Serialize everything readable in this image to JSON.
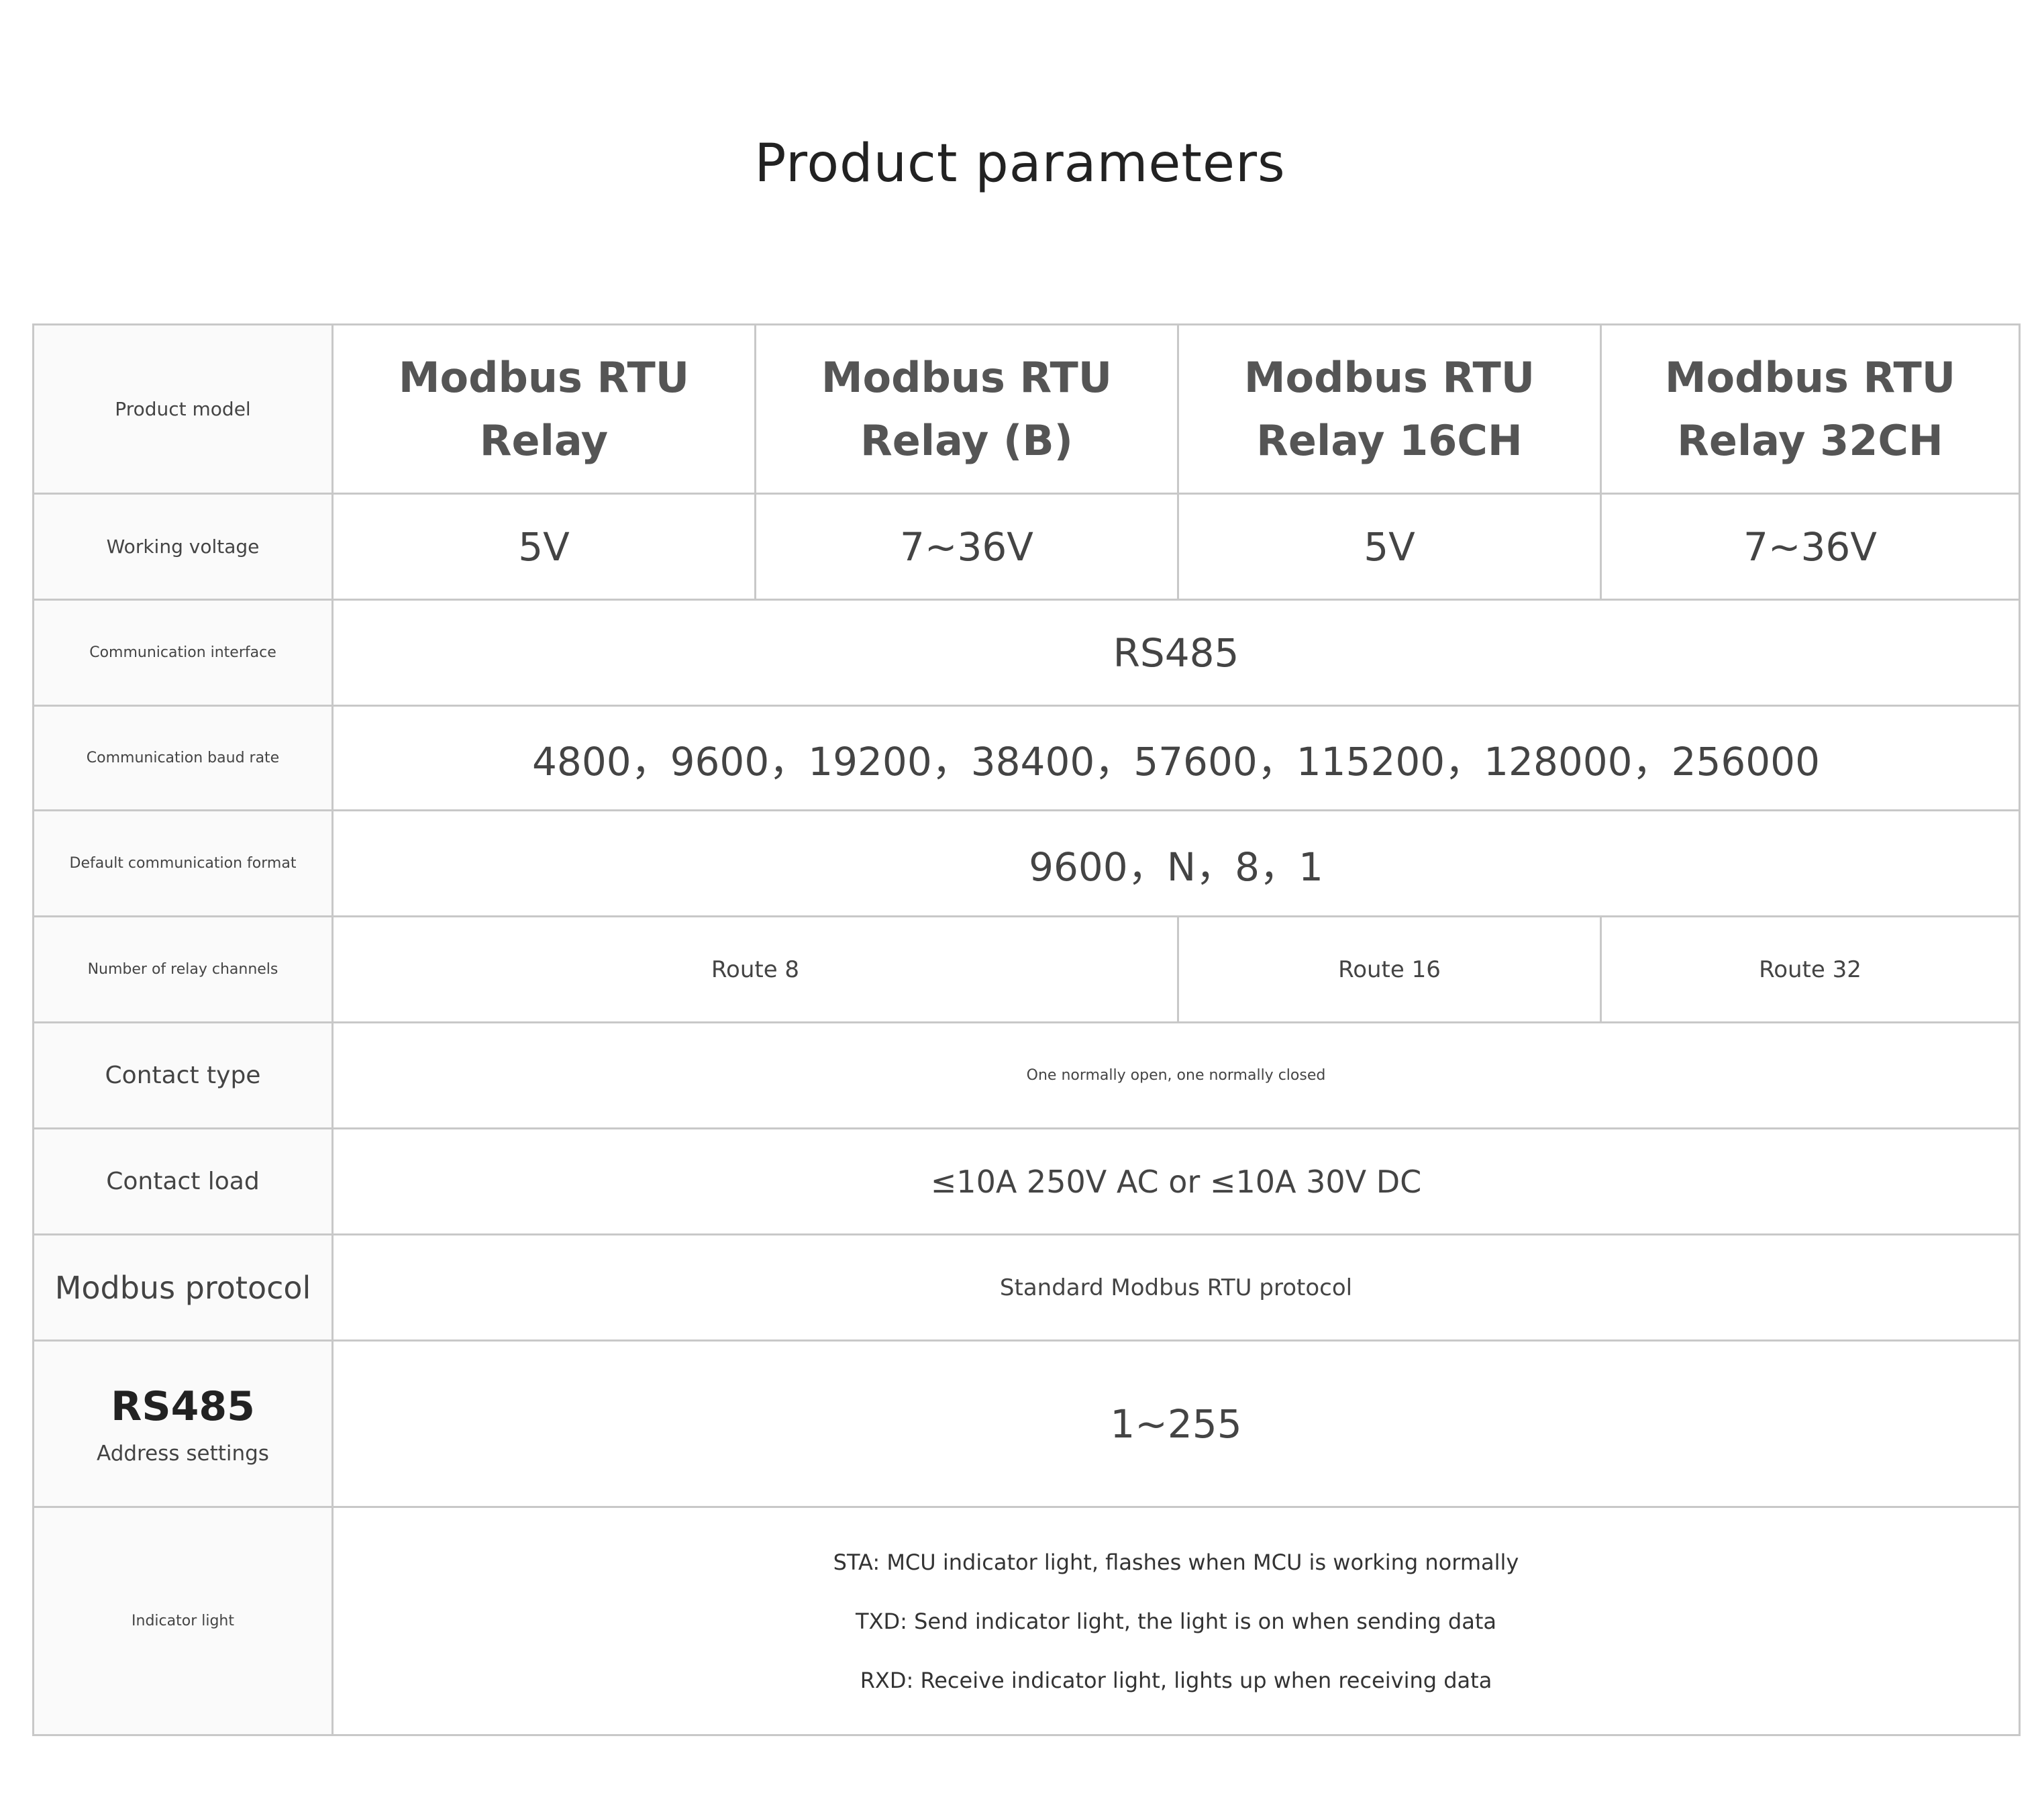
{
  "title": "Product parameters",
  "table": {
    "product_model": {
      "label": "Product model",
      "models": [
        {
          "line1": "Modbus RTU",
          "line2": "Relay"
        },
        {
          "line1": "Modbus RTU",
          "line2": "Relay (B)"
        },
        {
          "line1": "Modbus RTU",
          "line2": "Relay 16CH"
        },
        {
          "line1": "Modbus RTU",
          "line2": "Relay 32CH"
        }
      ]
    },
    "working_voltage": {
      "label": "Working voltage",
      "values": [
        "5V",
        "7~36V",
        "5V",
        "7~36V"
      ]
    },
    "communication_interface": {
      "label": "Communication interface",
      "value": "RS485"
    },
    "baud_rate": {
      "label": "Communication baud rate",
      "value": "4800，9600，19200，38400，57600，115200，128000，256000"
    },
    "default_format": {
      "label": "Default communication format",
      "value": "9600，N，8，1"
    },
    "relay_channels": {
      "label": "Number of relay channels",
      "values": [
        "Route 8",
        "Route 16",
        "Route 32"
      ]
    },
    "contact_type": {
      "label": "Contact type",
      "value": "One normally open, one normally closed"
    },
    "contact_load": {
      "label": "Contact load",
      "value": "≤10A 250V AC or ≤10A 30V DC"
    },
    "modbus_protocol": {
      "label": "Modbus protocol",
      "value": "Standard Modbus RTU protocol"
    },
    "address_settings": {
      "label_bold": "RS485",
      "label": "Address settings",
      "value": "1~255"
    },
    "indicator_light": {
      "label": "Indicator light",
      "lines": [
        "STA: MCU indicator light, flashes when MCU is working normally",
        "TXD: Send indicator light, the light is on when sending data",
        "RXD: Receive indicator light, lights up when receiving data"
      ]
    }
  }
}
